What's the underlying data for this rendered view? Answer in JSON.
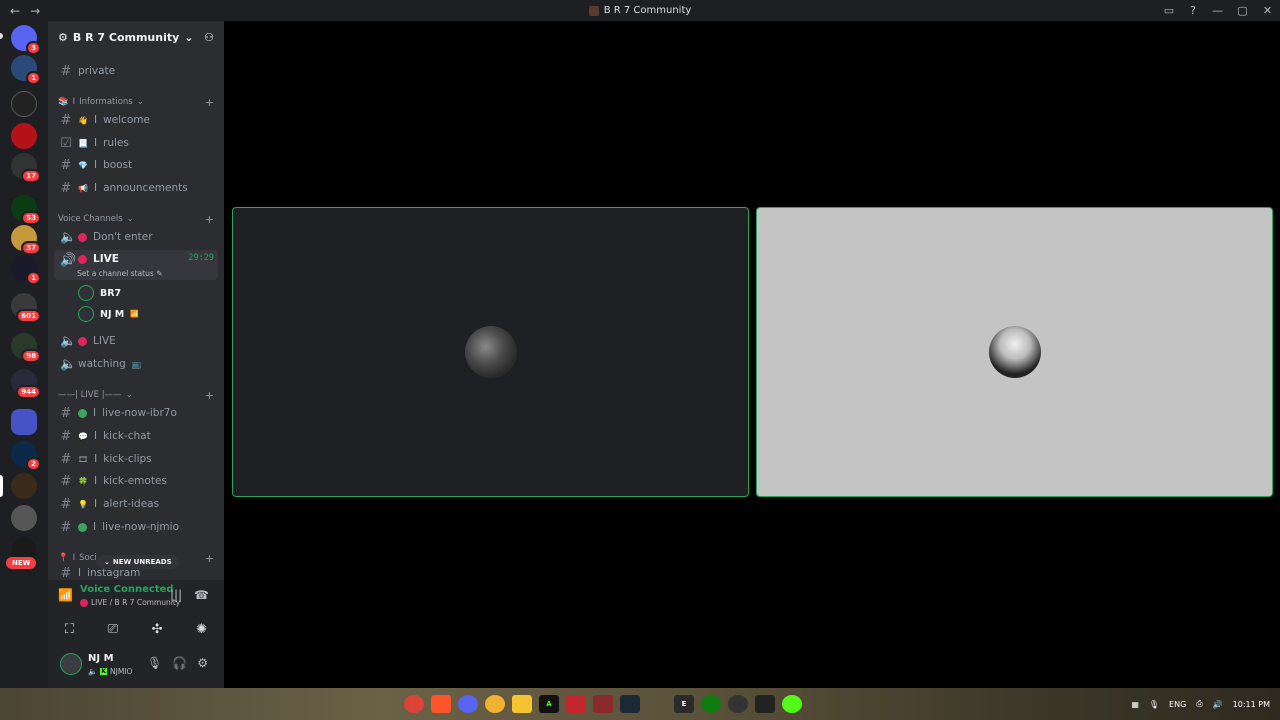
{
  "window": {
    "title": "B R 7 Community",
    "back": "←",
    "forward": "→"
  },
  "guilds": [
    {
      "badge": "3"
    },
    {
      "badge": "1"
    },
    {
      "badge": ""
    },
    {
      "badge": ""
    },
    {
      "badge": "17"
    },
    {
      "badge": "53"
    },
    {
      "badge": "37"
    },
    {
      "badge": "1"
    },
    {
      "badge": "601"
    },
    {
      "badge": "98"
    },
    {
      "badge": "944"
    },
    {
      "badge": ""
    },
    {
      "badge": "2"
    },
    {
      "badge": ""
    },
    {
      "badge": ""
    },
    {
      "badge": ""
    }
  ],
  "guilds_new_label": "NEW",
  "server": {
    "name": "B R 7 Community",
    "chevron": "⌄",
    "add_member": "⚇"
  },
  "channels": {
    "private": "private",
    "cat_info": "Informations",
    "welcome": "welcome",
    "rules": "rules",
    "boost": "boost",
    "announcements": "announcements",
    "cat_voice": "Voice Channels",
    "dont_enter": "Don't enter",
    "live": "LIVE",
    "live_timer": "29:29",
    "set_status": "Set a channel status",
    "member1": "BR7",
    "member2": "NJ M",
    "live2": "LIVE",
    "watching": "watching",
    "cat_live": "——| LIVE |——",
    "live_now_ibr7o": "live-now-ibr7o",
    "kick_chat": "kick-chat",
    "kick_clips": "kick-clips",
    "kick_emotes": "kick-emotes",
    "alert_ideas": "alert-ideas",
    "live_now_njmio": "live-now-njmio",
    "cat_social": "Soci",
    "instagram": "instagram",
    "sep": "I"
  },
  "new_unreads": "NEW UNREADS",
  "voice": {
    "status": "Voice Connected",
    "sub": "LIVE / B R 7 Community"
  },
  "user": {
    "name": "NJ M",
    "tag": "NJMIO"
  },
  "taskbar": {
    "lang": "ENG",
    "time": "10:11 PM"
  }
}
